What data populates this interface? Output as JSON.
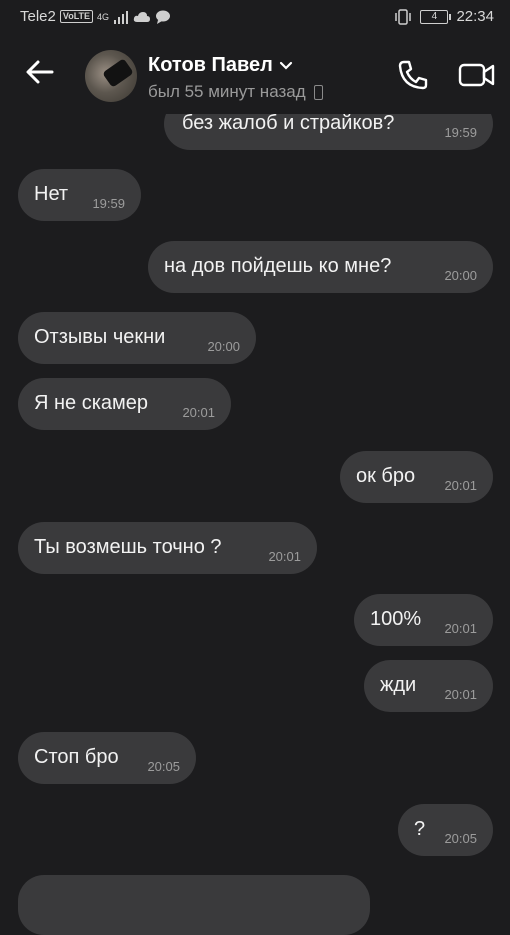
{
  "statusbar": {
    "carrier": "Tele2",
    "volte": "VoLTE",
    "network": "4G",
    "battery": "4",
    "time": "22:34"
  },
  "header": {
    "contact_name": "Котов Павел",
    "status": "был 55 минут назад"
  },
  "messages": [
    {
      "text": "без жалоб и страйков?",
      "time": "19:59",
      "outgoing": true
    },
    {
      "text": "Нет",
      "time": "19:59",
      "outgoing": false
    },
    {
      "text": "на дов пойдешь ко мне?",
      "time": "20:00",
      "outgoing": true
    },
    {
      "text": "Отзывы чекни",
      "time": "20:00",
      "outgoing": false
    },
    {
      "text": "Я не скамер",
      "time": "20:01",
      "outgoing": false
    },
    {
      "text": "ок бро",
      "time": "20:01",
      "outgoing": true
    },
    {
      "text": "Ты возмешь точно ?",
      "time": "20:01",
      "outgoing": false
    },
    {
      "text": "100%",
      "time": "20:01",
      "outgoing": true
    },
    {
      "text": "жди",
      "time": "20:01",
      "outgoing": true
    },
    {
      "text": "Стоп бро",
      "time": "20:05",
      "outgoing": false
    },
    {
      "text": "?",
      "time": "20:05",
      "outgoing": true
    }
  ]
}
